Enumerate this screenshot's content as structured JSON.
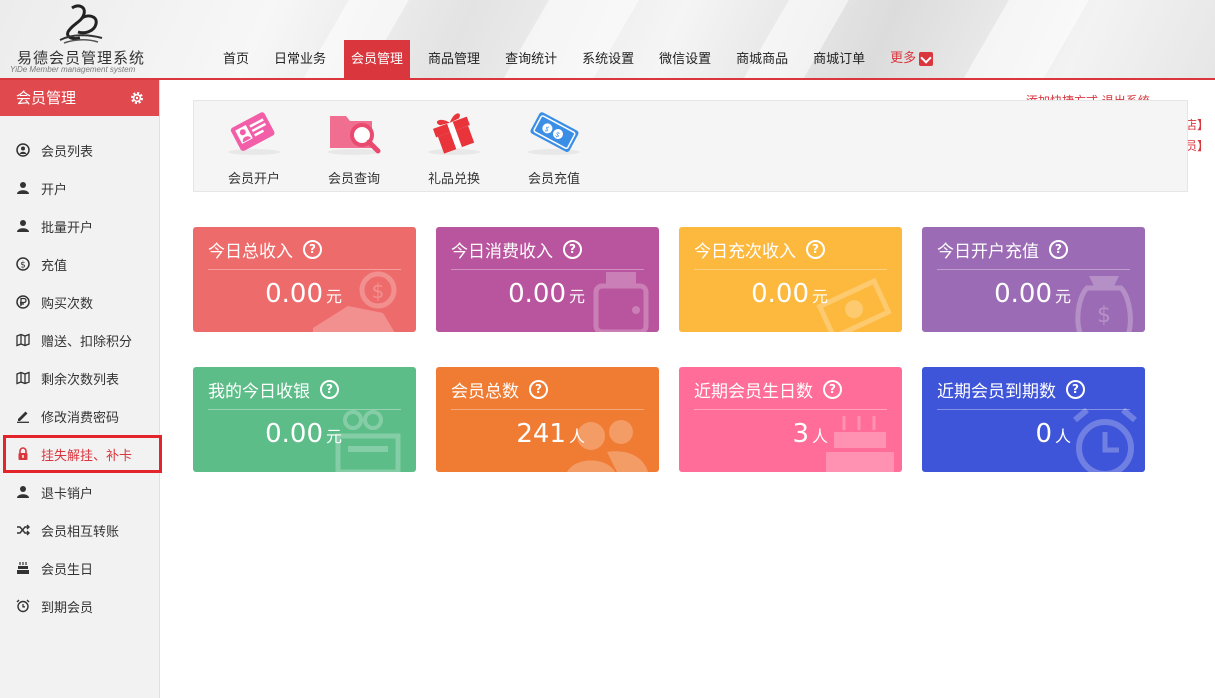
{
  "header": {
    "logo_title": "易德会员管理系统",
    "logo_sub": "YiDe Member management system",
    "nav": [
      {
        "label": "首页"
      },
      {
        "label": "日常业务"
      },
      {
        "label": "会员管理",
        "active": true
      },
      {
        "label": "商品管理"
      },
      {
        "label": "查询统计"
      },
      {
        "label": "系统设置"
      },
      {
        "label": "微信设置"
      },
      {
        "label": "商城商品"
      },
      {
        "label": "商城订单"
      }
    ],
    "more_label": "更多"
  },
  "top_right": {
    "line1": "添加快捷方式  退出系统",
    "line2": "店】",
    "line3": "员】"
  },
  "sidebar": {
    "title": "会员管理",
    "items": [
      {
        "label": "会员列表",
        "icon": "user-circle-icon"
      },
      {
        "label": "开户",
        "icon": "user-icon"
      },
      {
        "label": "批量开户",
        "icon": "user-icon"
      },
      {
        "label": "充值",
        "icon": "dollar-circle-icon"
      },
      {
        "label": "购买次数",
        "icon": "ruble-icon"
      },
      {
        "label": "赠送、扣除积分",
        "icon": "map-icon"
      },
      {
        "label": "剩余次数列表",
        "icon": "map-icon"
      },
      {
        "label": "修改消费密码",
        "icon": "pencil-icon"
      },
      {
        "label": "挂失解挂、补卡",
        "icon": "lock-icon",
        "selected": true
      },
      {
        "label": "退卡销户",
        "icon": "user-icon"
      },
      {
        "label": "会员相互转账",
        "icon": "shuffle-icon"
      },
      {
        "label": "会员生日",
        "icon": "cake-icon"
      },
      {
        "label": "到期会员",
        "icon": "alarm-icon"
      }
    ]
  },
  "quick_actions": [
    {
      "label": "会员开户",
      "icon": "member-card-icon"
    },
    {
      "label": "会员查询",
      "icon": "folder-search-icon"
    },
    {
      "label": "礼品兑换",
      "icon": "gift-icon"
    },
    {
      "label": "会员充值",
      "icon": "recharge-card-icon"
    }
  ],
  "cards": [
    {
      "title": "今日总收入",
      "value": "0.00",
      "unit": "元",
      "color": "#ee6b6b",
      "icon": "money-hand-icon"
    },
    {
      "title": "今日消费收入",
      "value": "0.00",
      "unit": "元",
      "color": "#b9549e",
      "icon": "wallet-icon"
    },
    {
      "title": "今日充次收入",
      "value": "0.00",
      "unit": "元",
      "color": "#fdb93e",
      "icon": "cash-icon"
    },
    {
      "title": "今日开户充值",
      "value": "0.00",
      "unit": "元",
      "color": "#9c6bb5",
      "icon": "money-bag-icon"
    },
    {
      "title": "我的今日收银",
      "value": "0.00",
      "unit": "元",
      "color": "#5cbd88",
      "icon": "register-icon"
    },
    {
      "title": "会员总数",
      "value": "241",
      "unit": "人",
      "color": "#f07b33",
      "icon": "people-icon"
    },
    {
      "title": "近期会员生日数",
      "value": "3",
      "unit": "人",
      "color": "#ff6d98",
      "icon": "cake-icon"
    },
    {
      "title": "近期会员到期数",
      "value": "0",
      "unit": "人",
      "color": "#3f55d9",
      "icon": "alarm-clock-icon"
    }
  ]
}
